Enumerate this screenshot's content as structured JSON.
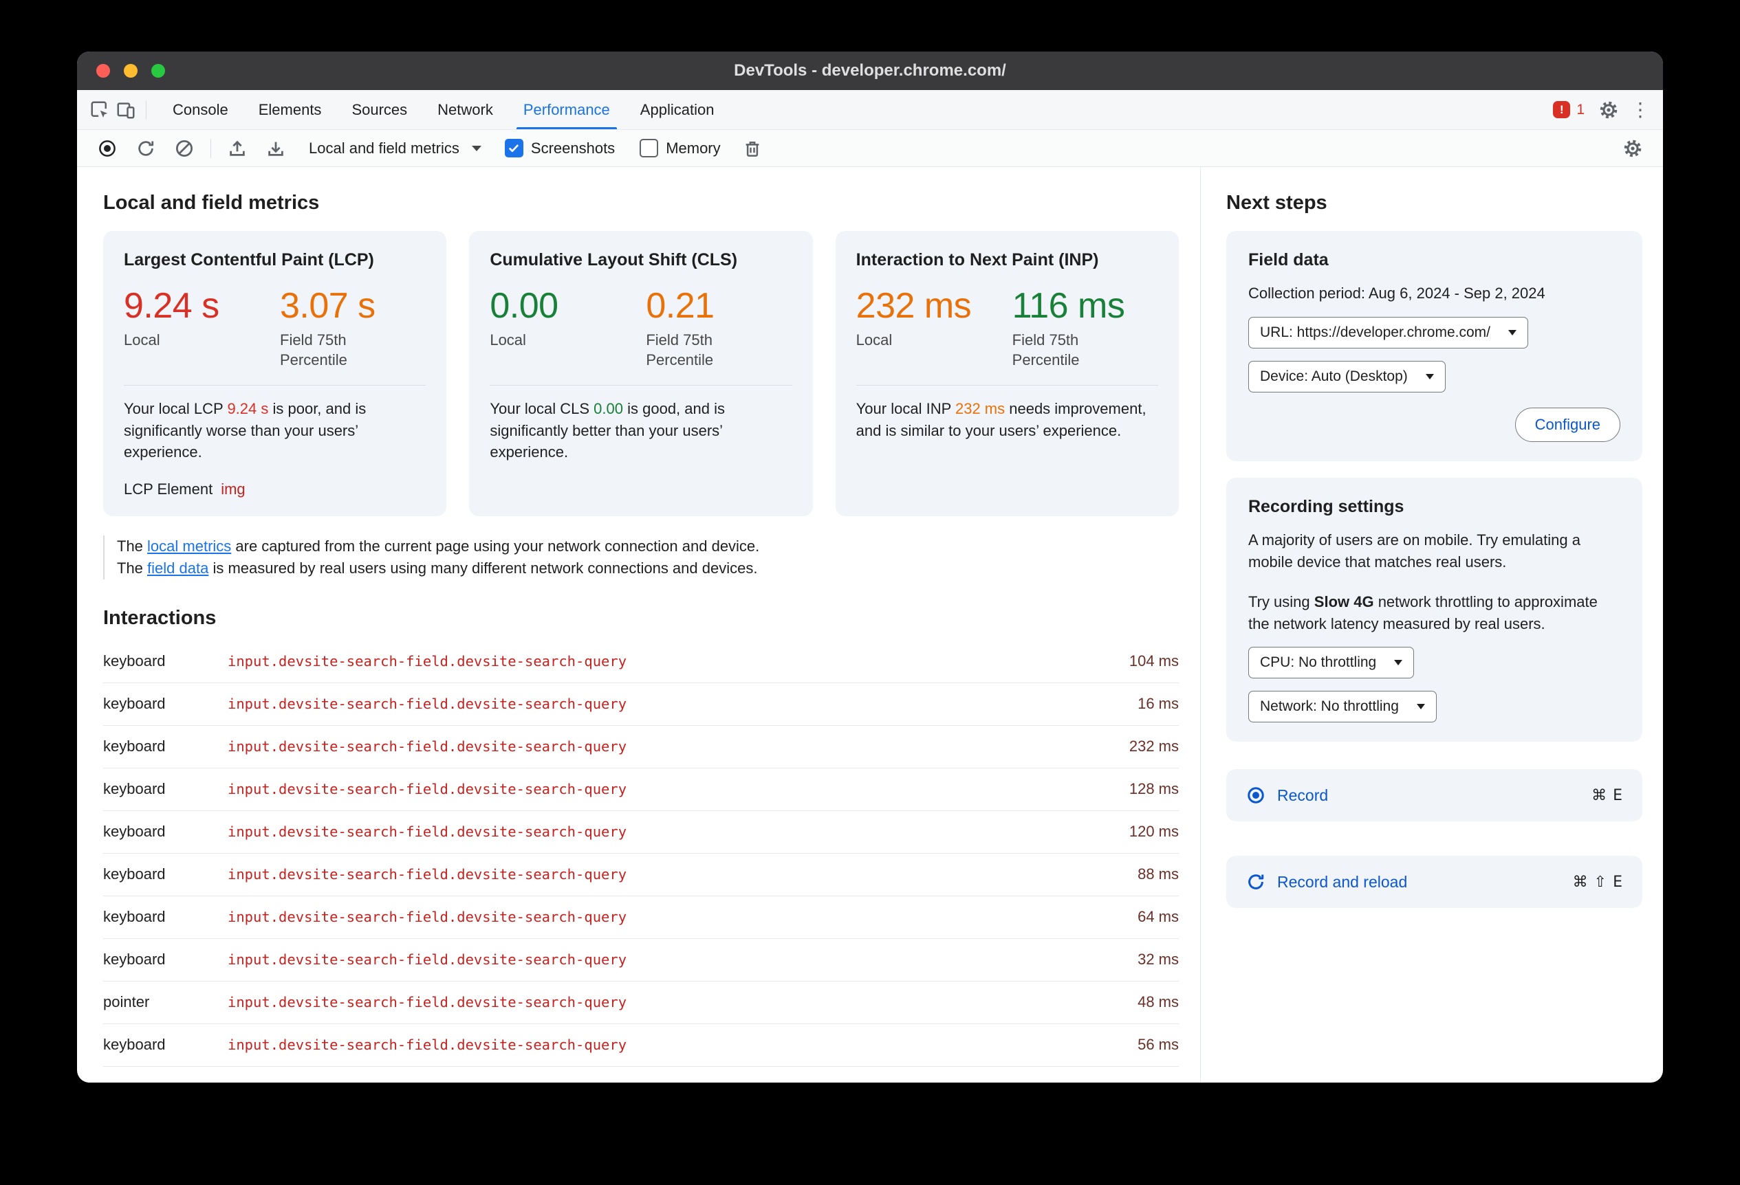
{
  "colors": {
    "red": "#d93025",
    "orange": "#e8710a",
    "green": "#188038",
    "link": "#1a73e8",
    "accent": "#0b57d0",
    "node": "#c5221f",
    "duration": "#6b2f28",
    "error": "#d93025"
  },
  "window": {
    "title": "DevTools - developer.chrome.com/"
  },
  "tabbar": {
    "tabs": [
      {
        "label": "Console",
        "active": false
      },
      {
        "label": "Elements",
        "active": false
      },
      {
        "label": "Sources",
        "active": false
      },
      {
        "label": "Network",
        "active": false
      },
      {
        "label": "Performance",
        "active": true
      },
      {
        "label": "Application",
        "active": false
      }
    ],
    "error_count": "1"
  },
  "toolbar": {
    "history_dropdown_label": "Local and field metrics",
    "screenshots_label": "Screenshots",
    "memory_label": "Memory"
  },
  "main": {
    "heading": "Local and field metrics",
    "cards": [
      {
        "title": "Largest Contentful Paint (LCP)",
        "local_value": "9.24 s",
        "local_label": "Local",
        "field_value": "3.07 s",
        "field_label": "Field 75th Percentile",
        "desc": {
          "before": "Your local LCP ",
          "value": "9.24 s",
          "after": " is poor, and is significantly worse than your users’ experience."
        },
        "element_label": "LCP Element",
        "element_link": "img"
      },
      {
        "title": "Cumulative Layout Shift (CLS)",
        "local_value": "0.00",
        "local_label": "Local",
        "field_value": "0.21",
        "field_label": "Field 75th Percentile",
        "desc": {
          "before": "Your local CLS ",
          "value": "0.00",
          "after": " is good, and is significantly better than your users’ experience."
        }
      },
      {
        "title": "Interaction to Next Paint (INP)",
        "local_value": "232 ms",
        "local_label": "Local",
        "field_value": "116 ms",
        "field_label": "Field 75th Percentile",
        "desc": {
          "before": "Your local INP ",
          "value": "232 ms",
          "after": " needs improvement, and is similar to your users’ experience."
        }
      }
    ],
    "note": {
      "line1": {
        "before": "The ",
        "link": "local metrics",
        "after": " are captured from the current page using your network connection and device."
      },
      "line2": {
        "before": "The ",
        "link": "field data",
        "after": " is measured by real users using many different network connections and devices."
      }
    },
    "interactions": {
      "heading": "Interactions",
      "rows": [
        {
          "type": "keyboard",
          "target": "input.devsite-search-field.devsite-search-query",
          "duration": "104 ms"
        },
        {
          "type": "keyboard",
          "target": "input.devsite-search-field.devsite-search-query",
          "duration": "16 ms"
        },
        {
          "type": "keyboard",
          "target": "input.devsite-search-field.devsite-search-query",
          "duration": "232 ms"
        },
        {
          "type": "keyboard",
          "target": "input.devsite-search-field.devsite-search-query",
          "duration": "128 ms"
        },
        {
          "type": "keyboard",
          "target": "input.devsite-search-field.devsite-search-query",
          "duration": "120 ms"
        },
        {
          "type": "keyboard",
          "target": "input.devsite-search-field.devsite-search-query",
          "duration": "88 ms"
        },
        {
          "type": "keyboard",
          "target": "input.devsite-search-field.devsite-search-query",
          "duration": "64 ms"
        },
        {
          "type": "keyboard",
          "target": "input.devsite-search-field.devsite-search-query",
          "duration": "32 ms"
        },
        {
          "type": "pointer",
          "target": "input.devsite-search-field.devsite-search-query",
          "duration": "48 ms"
        },
        {
          "type": "keyboard",
          "target": "input.devsite-search-field.devsite-search-query",
          "duration": "56 ms"
        }
      ]
    }
  },
  "sidebar": {
    "heading": "Next steps",
    "field_data": {
      "title": "Field data",
      "collection_period": "Collection period: Aug 6, 2024 - Sep 2, 2024",
      "url_select": "URL: https://developer.chrome.com/",
      "device_select": "Device: Auto (Desktop)",
      "configure_button": "Configure"
    },
    "recording_settings": {
      "title": "Recording settings",
      "p1": "A majority of users are on mobile. Try emulating a mobile device that matches real users.",
      "p2_before": "Try using ",
      "p2_bold": "Slow 4G",
      "p2_after": " network throttling to approximate the network latency measured by real users.",
      "cpu_select": "CPU: No throttling",
      "network_select": "Network: No throttling"
    },
    "record": {
      "label": "Record",
      "shortcut": "⌘ E"
    },
    "record_reload": {
      "label": "Record and reload",
      "shortcut": "⌘ ⇧ E"
    }
  }
}
